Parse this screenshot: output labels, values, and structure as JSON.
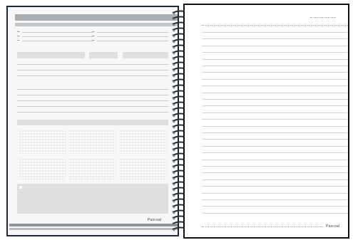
{
  "notebook": {
    "brand": "Pascoal",
    "left_page_type": "planner",
    "right_page_type": "lined-notes",
    "cover_color": "#1d2a3a",
    "accent_gray": "#a9aeb2",
    "panel_gray": "#dde0df"
  }
}
